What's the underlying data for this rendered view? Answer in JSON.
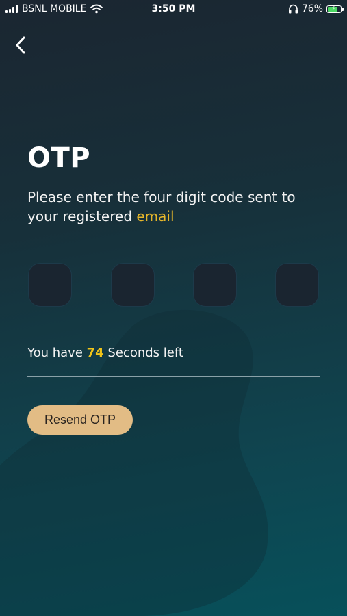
{
  "status_bar": {
    "carrier": "BSNL MOBILE",
    "time": "3:50 PM",
    "battery": "76%"
  },
  "icons": {
    "back": "chevron-left-icon",
    "signal": "signal-bars-icon",
    "wifi": "wifi-icon",
    "headphones": "headphones-icon",
    "battery": "battery-charging-icon"
  },
  "page": {
    "title": "OTP",
    "subtitle_prefix": "Please enter the four digit code sent to your registered ",
    "subtitle_highlight": "email"
  },
  "otp": {
    "digits": [
      "",
      "",
      "",
      ""
    ]
  },
  "timer": {
    "prefix": "You have ",
    "seconds": "74",
    "suffix": " Seconds left"
  },
  "actions": {
    "resend_label": "Resend OTP"
  },
  "colors": {
    "accent": "#e8b82a",
    "timer_accent": "#f0c419",
    "button_bg": "#e2bc85",
    "otp_box_bg": "#1a2530",
    "background_top": "#1b2631",
    "background_bottom": "#07505a"
  }
}
